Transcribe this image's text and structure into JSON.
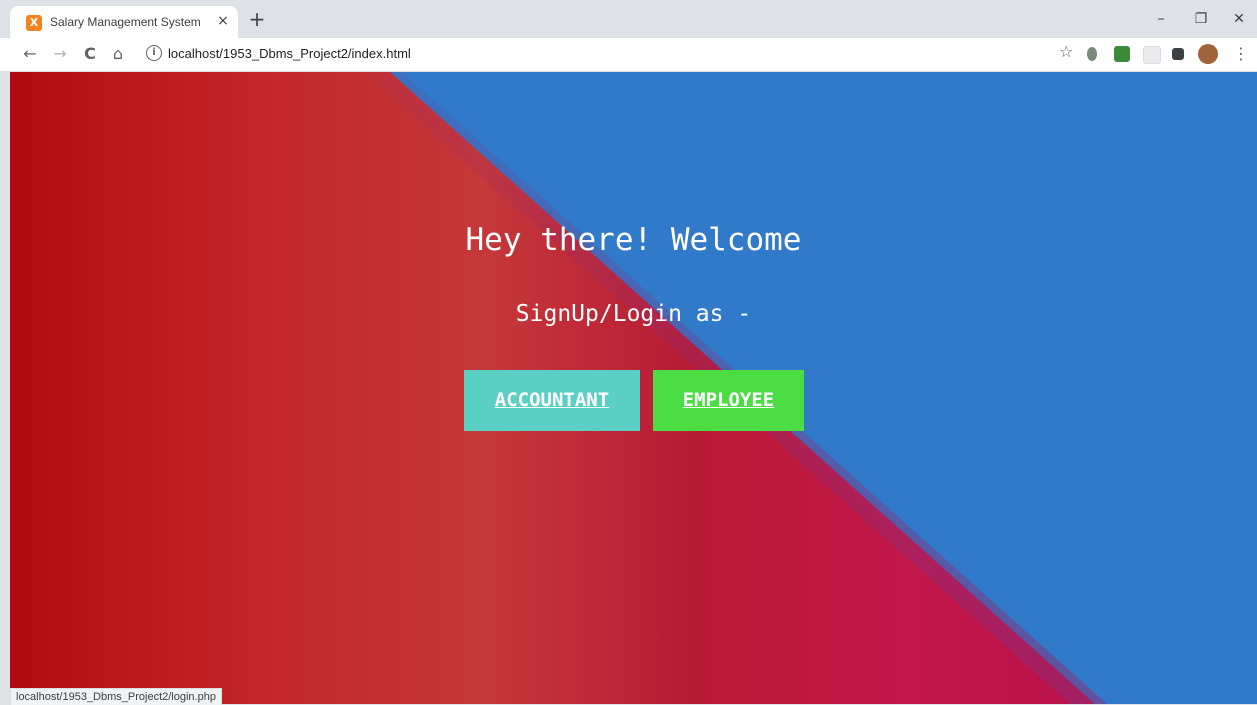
{
  "tab": {
    "title": "Salary Management System",
    "favicon_glyph": "X",
    "close": "×"
  },
  "newtab_label": "+",
  "window_controls": {
    "minimize": "–",
    "restore": "❐",
    "close": "✕"
  },
  "nav": {
    "back": "←",
    "forward": "→",
    "reload": "C",
    "home": "⌂"
  },
  "omnibox": {
    "info": "i",
    "url": "localhost/1953_Dbms_Project2/index.html"
  },
  "toolbar_icons": {
    "star": "☆",
    "menu": "⋮"
  },
  "page": {
    "welcome": "Hey there! Welcome",
    "subtitle": "SignUp/Login as -",
    "accountant_button": "ACCOUNTANT",
    "employee_button": "EMPLOYEE"
  },
  "status_url": "localhost/1953_Dbms_Project2/login.php",
  "colors": {
    "accountant": "#5ccfc4",
    "employee": "#4cdd45",
    "sky": "#3179c9",
    "red": "#b81a2a"
  }
}
